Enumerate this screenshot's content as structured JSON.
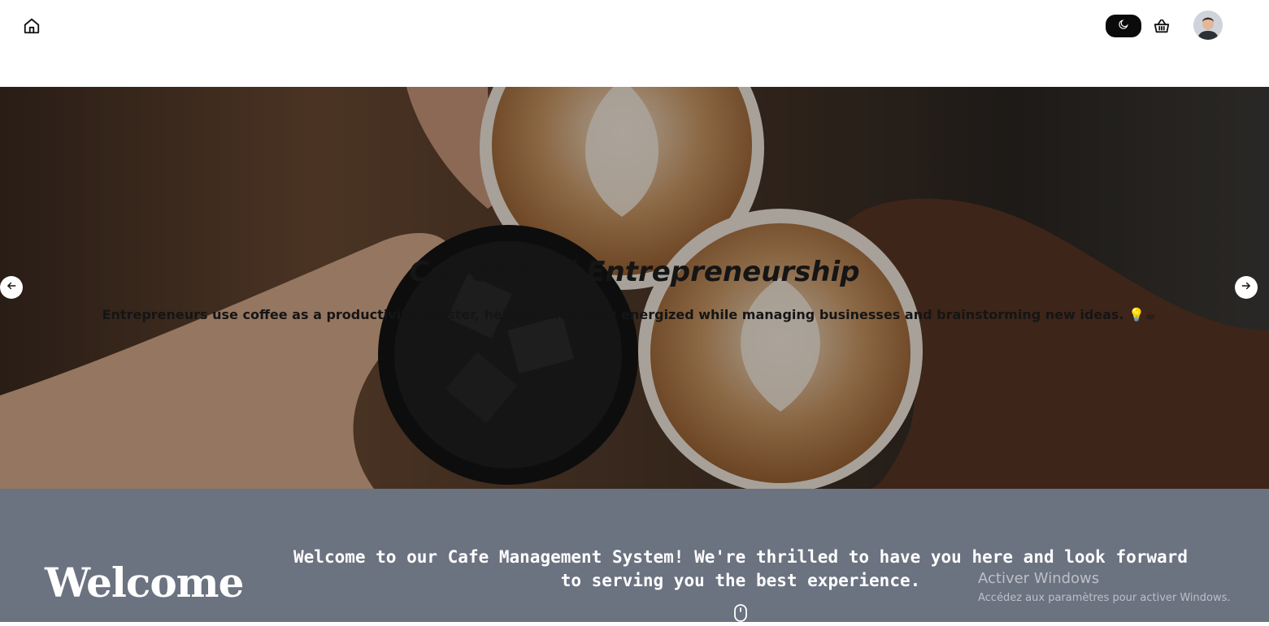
{
  "header": {
    "home_icon": "home-icon",
    "theme_icon": "moon-icon",
    "cart_icon": "basket-icon",
    "avatar_icon": "user-avatar"
  },
  "hero": {
    "title": "Coffee and Entrepreneurship",
    "description": "Entrepreneurs use coffee as a productivity booster, helping them stay energized while managing businesses and brainstorming new ideas. 💡☕",
    "prev_icon": "arrow-left-icon",
    "next_icon": "arrow-right-icon"
  },
  "welcome": {
    "heading": "Welcome",
    "text": "Welcome to our Cafe Management System! We're thrilled to have you here and look forward to serving you the best experience.",
    "scroll_icon": "mouse-scroll-icon"
  },
  "watermark": {
    "title": "Activer Windows",
    "subtitle": "Accédez aux paramètres pour activer Windows."
  },
  "colors": {
    "welcome_bg": "#6b7280",
    "toggle_bg": "#0b0b0b",
    "hero_text": "#151515"
  }
}
